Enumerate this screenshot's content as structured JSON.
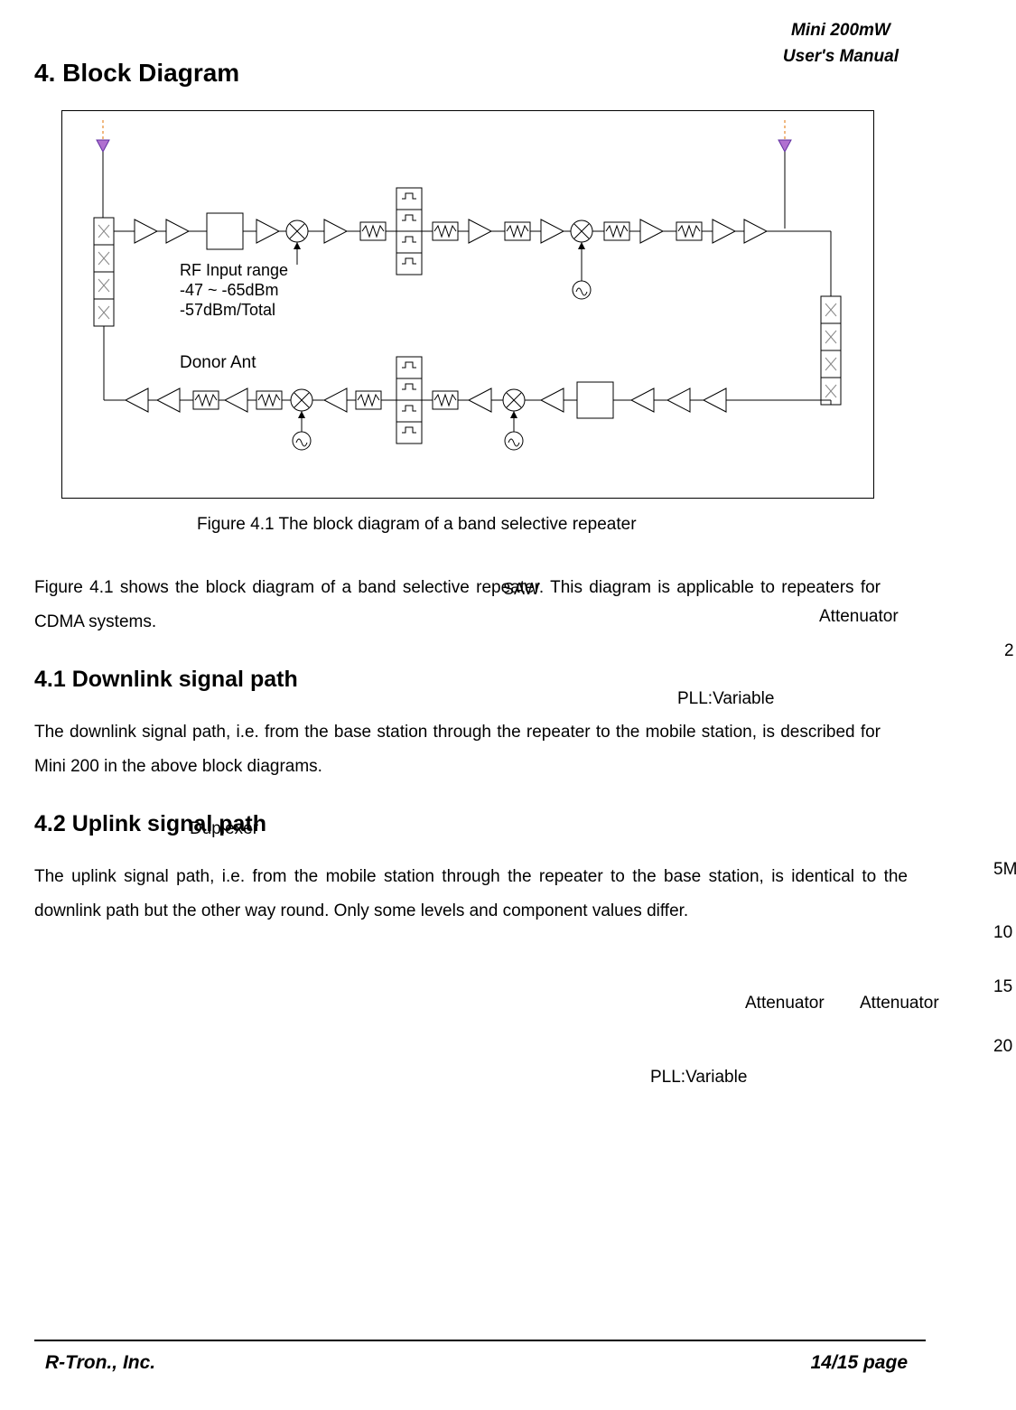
{
  "header": {
    "line1": "Mini 200mW",
    "line2": "User's Manual"
  },
  "section_heading": "4. Block Diagram",
  "diagram": {
    "rf_input_line1": "RF Input range",
    "rf_input_line2": "-47 ~ -65dBm",
    "rf_input_line3": "-57dBm/Total",
    "donor_ant": "Donor Ant"
  },
  "figure_caption": "Figure 4.1 The block diagram of a band selective repeater",
  "para1": "Figure 4.1 shows the block diagram of a band selective repeater. This diagram is applicable to repeaters for CDMA systems.",
  "subheading1": "4.1 Downlink signal path",
  "para2": "The downlink signal path, i.e. from the base station through the repeater to the mobile station, is described for Mini 200 in the above block diagrams.",
  "subheading2": "4.2 Uplink signal path",
  "para3": "The uplink signal path, i.e. from the mobile station through the repeater to the base station, is identical to the downlink path but the other way round. Only some levels and component values differ.",
  "stray_labels": {
    "saw": "SAW",
    "attenuator": "Attenuator",
    "two": "2",
    "pll_variable": "PLL:Variable",
    "duplexer": "Duplexer",
    "five_m": "5M",
    "ten": "10",
    "fifteen": "15",
    "twenty": "20"
  },
  "footer": {
    "left": "R-Tron., Inc.",
    "right": "14/15 page"
  }
}
